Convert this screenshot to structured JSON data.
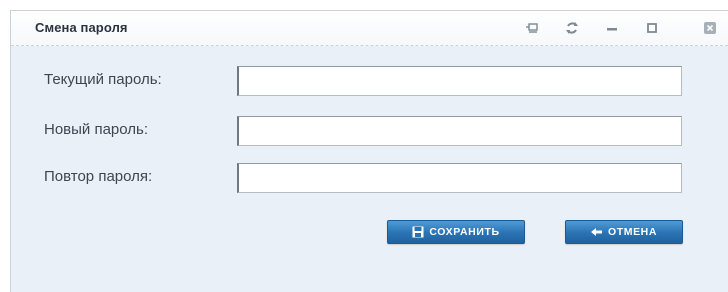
{
  "window": {
    "title": "Смена пароля",
    "controls": [
      "pin-icon",
      "refresh-icon",
      "minimize-icon",
      "maximize-icon",
      "close-icon"
    ]
  },
  "form": {
    "current_password": {
      "label": "Текущий пароль:",
      "value": ""
    },
    "new_password": {
      "label": "Новый пароль:",
      "value": ""
    },
    "repeat_password": {
      "label": "Повтор пароля:",
      "value": ""
    }
  },
  "actions": {
    "save_label": "СОХРАНИТЬ",
    "cancel_label": "ОТМЕНА"
  },
  "colors": {
    "accent": "#2a73b3",
    "panel": "#e9f0f7"
  }
}
